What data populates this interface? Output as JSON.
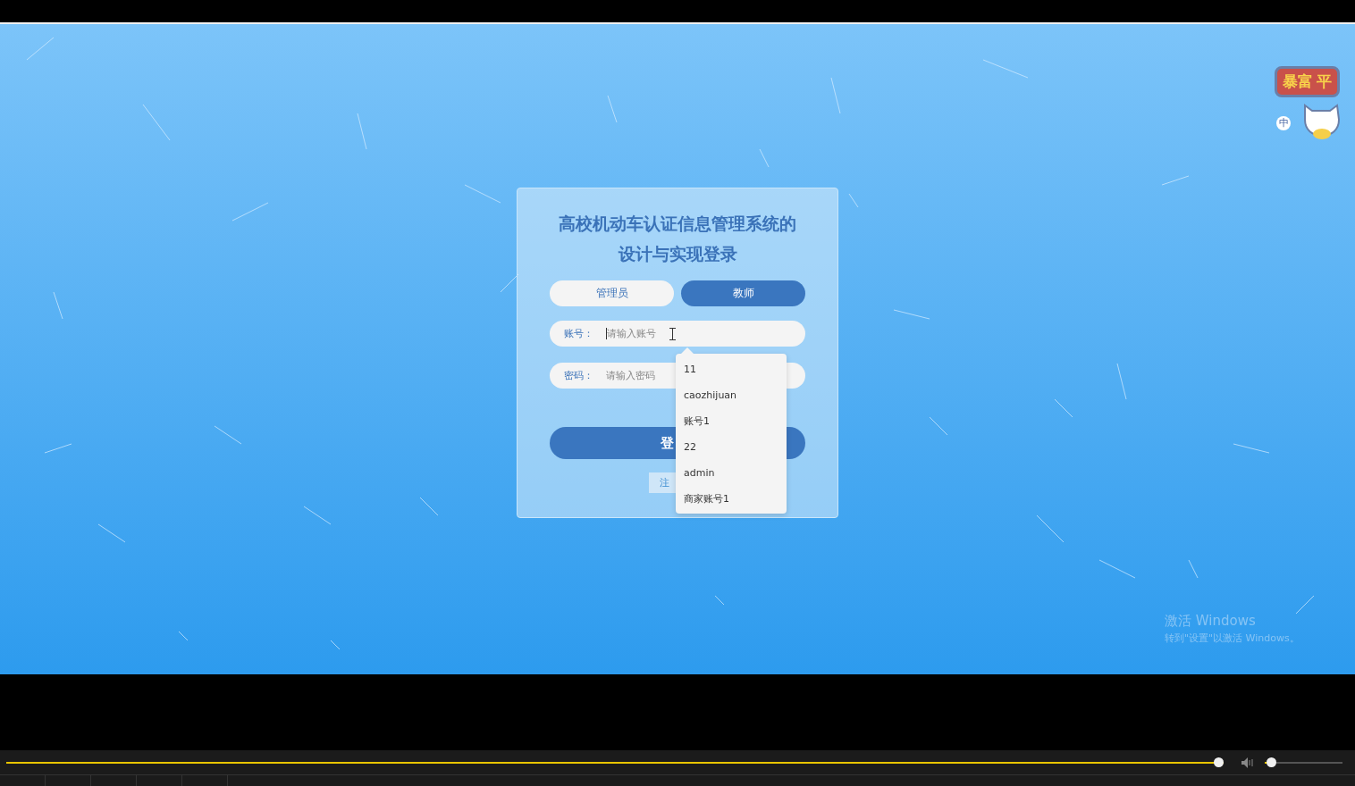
{
  "login_card": {
    "title": "高校机动车认证信息管理系统的设计与实现登录",
    "roles": [
      {
        "label": "管理员",
        "selected": false
      },
      {
        "label": "教师",
        "selected": true
      }
    ],
    "fields": [
      {
        "label": "账号：",
        "placeholder": "请输入账号",
        "focused": true
      },
      {
        "label": "密码：",
        "placeholder": "请输入密码",
        "focused": false
      }
    ],
    "login_button": "登",
    "register_link": "注",
    "autocomplete": {
      "items": [
        "11",
        "caozhijuan",
        "账号1",
        "22",
        "admin",
        "商家账号1"
      ]
    }
  },
  "sticker": {
    "texts": [
      "暴富",
      "平"
    ],
    "ime_indicator": "中"
  },
  "activation_notice": {
    "title": "激活 Windows",
    "subtitle": "转到\"设置\"以激活 Windows。"
  },
  "player": {
    "progress": {
      "level": 1
    },
    "volume": {
      "level": 0.08
    }
  }
}
